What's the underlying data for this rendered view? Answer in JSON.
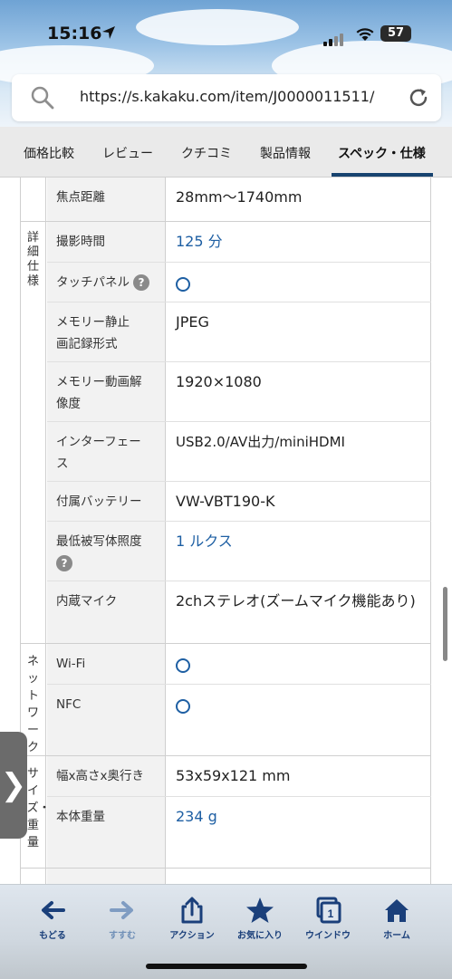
{
  "status": {
    "time": "15:16",
    "battery": "57"
  },
  "browser": {
    "url": "https://s.kakaku.com/item/J0000011511/"
  },
  "tabs": [
    {
      "label": "価格比較"
    },
    {
      "label": "レビュー"
    },
    {
      "label": "クチコミ"
    },
    {
      "label": "製品情報"
    },
    {
      "label": "スペック・仕様"
    }
  ],
  "active_tab": "スペック・仕様",
  "spec": {
    "focal": {
      "key": "焦点距離",
      "value": "28mm〜1740mm"
    },
    "groups": [
      {
        "label": "詳細仕様",
        "rows": [
          {
            "key": "撮影時間",
            "value": "125 分",
            "link": true
          },
          {
            "key": "タッチパネル",
            "value": "○",
            "help": "?"
          },
          {
            "key": "メモリー静止画記録形式",
            "value": "JPEG"
          },
          {
            "key": "メモリー動画解像度",
            "value": "1920×1080"
          },
          {
            "key": "インターフェース",
            "value": "USB2.0/AV出力/miniHDMI"
          },
          {
            "key": "付属バッテリー",
            "value": "VW-VBT190-K"
          },
          {
            "key": "最低被写体照度",
            "value": "1 ルクス",
            "link": true,
            "help": "?"
          },
          {
            "key": "内蔵マイク",
            "value": "2chステレオ(ズームマイク機能あり)"
          }
        ]
      },
      {
        "label": "ネットワーク",
        "rows": [
          {
            "key": "Wi-Fi",
            "value": "○"
          },
          {
            "key": "NFC",
            "value": "○"
          }
        ]
      },
      {
        "label": "サイズ・重量",
        "rows": [
          {
            "key": "幅x高さx奥行き",
            "value": "53x59x121 mm"
          },
          {
            "key": "本体重量",
            "value": "234 g",
            "link": true
          }
        ]
      }
    ]
  },
  "toolbar": {
    "back": "もどる",
    "forward": "すすむ",
    "action": "アクション",
    "favorite": "お気に入り",
    "window": "ウインドウ",
    "window_count": "1",
    "home": "ホーム"
  },
  "colors": {
    "link": "#1e5fa3",
    "active_tab_underline": "#17436f",
    "toolbar_icon": "#1a3f7a"
  }
}
